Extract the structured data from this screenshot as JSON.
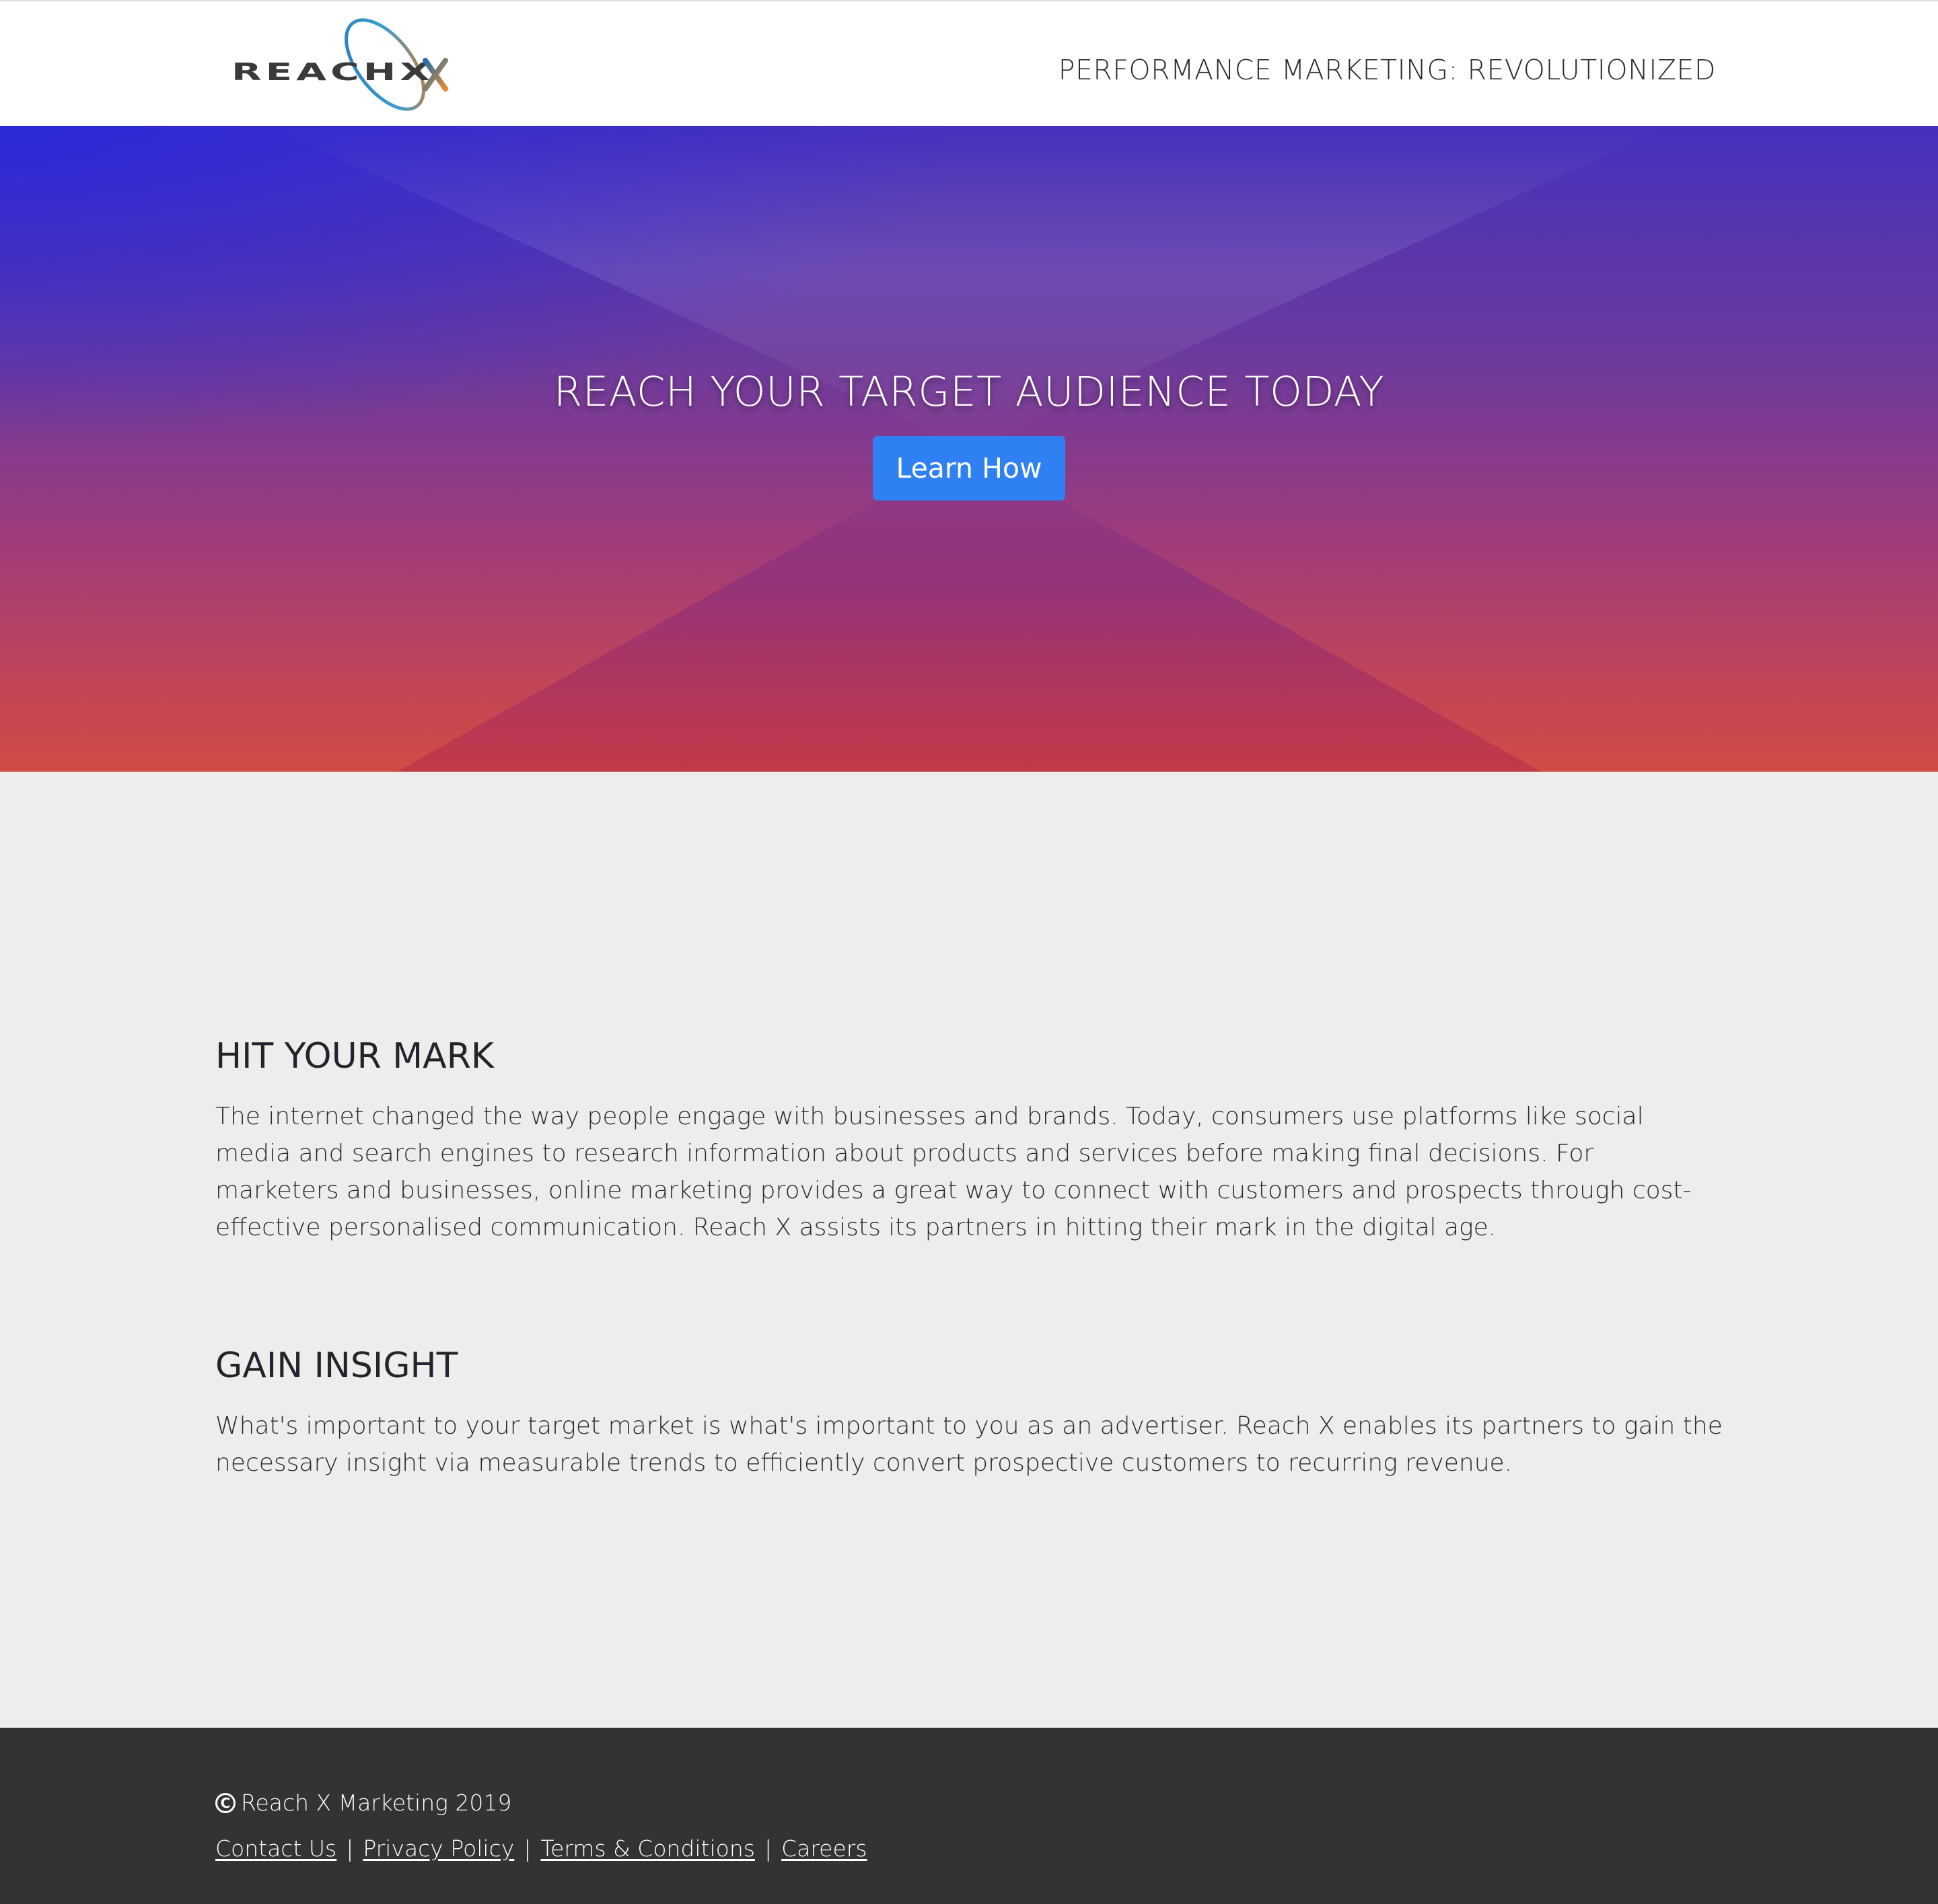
{
  "header": {
    "logo_text": "REACHX",
    "tagline": "PERFORMANCE MARKETING: REVOLUTIONIZED"
  },
  "hero": {
    "title": "REACH YOUR TARGET AUDIENCE TODAY",
    "button_label": "Learn How"
  },
  "sections": [
    {
      "heading": "HIT YOUR MARK",
      "body": "The internet changed the way people engage with businesses and brands. Today, consumers use platforms like social media and search engines to research information about products and services before making final decisions. For marketers and businesses, online marketing provides a great way to connect with customers and prospects through cost-effective personalised communication. Reach X assists its partners in hitting their mark in the digital age."
    },
    {
      "heading": "GAIN INSIGHT",
      "body": "What's important to your target market is what's important to you as an advertiser. Reach X enables its partners to gain the necessary insight via measurable trends to efficiently convert prospective customers to recurring revenue."
    }
  ],
  "footer": {
    "copyright_symbol": "C",
    "copyright": "Reach X Marketing 2019",
    "links": [
      {
        "label": "Contact Us"
      },
      {
        "label": "Privacy Policy"
      },
      {
        "label": "Terms & Conditions"
      },
      {
        "label": "Careers"
      }
    ],
    "separator": "|"
  },
  "colors": {
    "accent_button": "#2f80f2",
    "footer_bg": "#333333",
    "content_bg": "#ededed"
  }
}
